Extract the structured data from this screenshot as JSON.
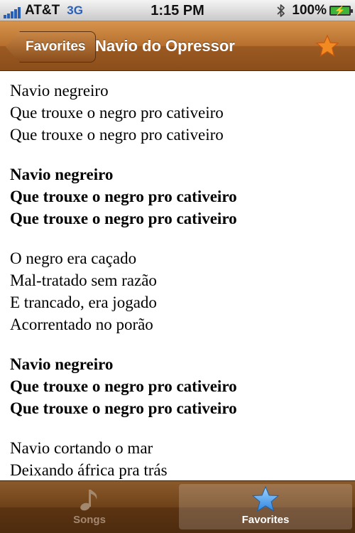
{
  "status_bar": {
    "carrier": "AT&T",
    "network": "3G",
    "time": "1:15 PM",
    "battery_percent": "100%",
    "icons": [
      "signal-bars-icon",
      "bluetooth-icon",
      "battery-charging-icon"
    ]
  },
  "nav": {
    "back_label": "Favorites",
    "title": "Navio do Opressor",
    "right_icon": "star-icon"
  },
  "lyrics": {
    "stanzas": [
      {
        "bold": false,
        "lines": [
          "Navio negreiro",
          "Que trouxe o negro pro cativeiro",
          "Que trouxe o negro pro cativeiro"
        ]
      },
      {
        "bold": true,
        "lines": [
          "Navio negreiro",
          "Que trouxe o negro pro cativeiro",
          "Que trouxe o negro pro cativeiro"
        ]
      },
      {
        "bold": false,
        "lines": [
          "O negro era caçado",
          "Mal-tratado sem razão",
          "E trancado, era jogado",
          "Acorrentado no porão"
        ]
      },
      {
        "bold": true,
        "lines": [
          "Navio negreiro",
          "Que trouxe o negro pro cativeiro",
          "Que trouxe o negro pro cativeiro"
        ]
      },
      {
        "bold": false,
        "lines": [
          "Navio cortando o mar",
          "Deixando áfrica pra trás"
        ]
      }
    ]
  },
  "tab_bar": {
    "tabs": [
      {
        "label": "Songs",
        "icon": "music-note-icon",
        "selected": false
      },
      {
        "label": "Favorites",
        "icon": "star-icon",
        "selected": true
      }
    ]
  },
  "colors": {
    "nav_brown": "#b66f2e",
    "tab_brown": "#5c3412",
    "star_orange": "#f28a22",
    "selected_star_blue": "#4aa3f0",
    "signal_blue": "#2a5fb8"
  }
}
